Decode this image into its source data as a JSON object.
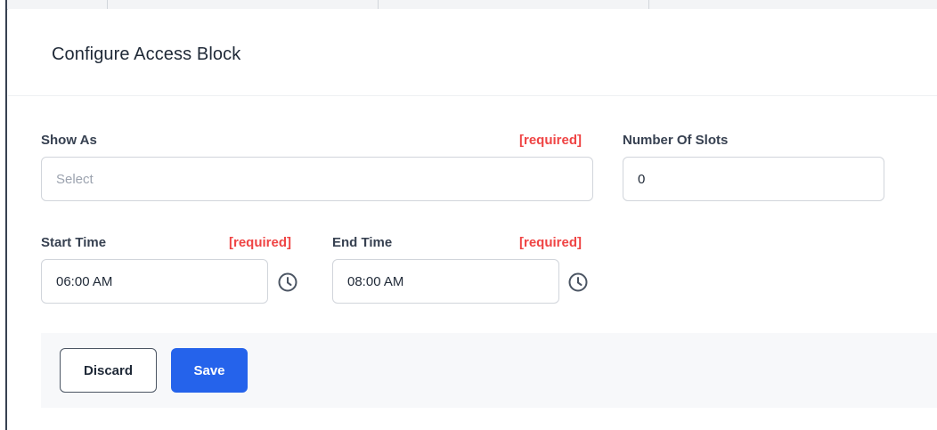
{
  "modal": {
    "title": "Configure Access Block"
  },
  "form": {
    "show_as": {
      "label": "Show As",
      "required": "[required]",
      "placeholder": "Select"
    },
    "number_of_slots": {
      "label": "Number Of Slots",
      "value": "0"
    },
    "start_time": {
      "label": "Start Time",
      "required": "[required]",
      "value": "06:00 AM"
    },
    "end_time": {
      "label": "End Time",
      "required": "[required]",
      "value": "08:00 AM"
    }
  },
  "footer": {
    "discard_label": "Discard",
    "save_label": "Save"
  },
  "icons": {
    "start_clock": "clock-icon",
    "end_clock": "clock-icon"
  },
  "colors": {
    "required": "#ef4444",
    "primary": "#2563eb"
  }
}
